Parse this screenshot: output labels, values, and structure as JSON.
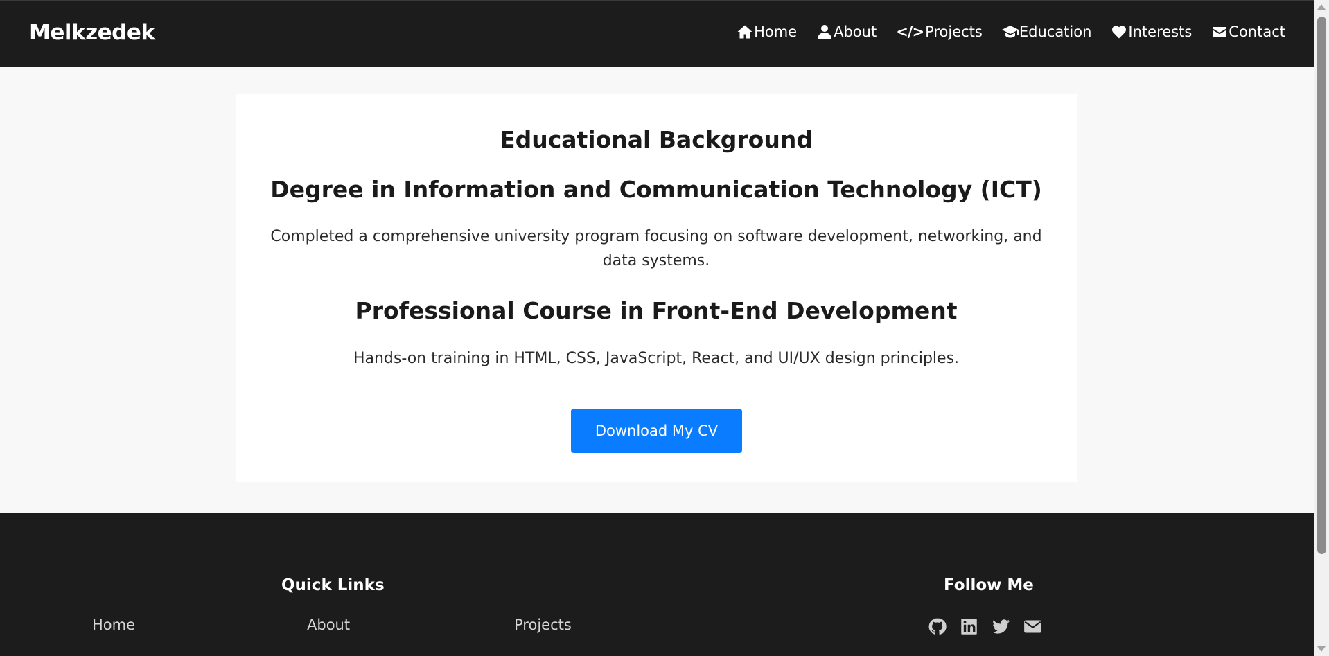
{
  "header": {
    "brand": "Melkzedek",
    "nav": [
      {
        "label": "Home",
        "icon": "home-icon"
      },
      {
        "label": "About",
        "icon": "user-icon"
      },
      {
        "label": "Projects",
        "icon": "code-icon"
      },
      {
        "label": "Education",
        "icon": "graduation-cap-icon"
      },
      {
        "label": "Interests",
        "icon": "heart-icon"
      },
      {
        "label": "Contact",
        "icon": "envelope-icon"
      }
    ]
  },
  "education": {
    "title": "Educational Background",
    "degree": {
      "title": "Degree in Information and Communication Technology (ICT)",
      "description": "Completed a comprehensive university program focusing on software development, networking, and data systems."
    },
    "course": {
      "title": "Professional Course in Front-End Development",
      "description": "Hands-on training in HTML, CSS, JavaScript, React, and UI/UX design principles."
    },
    "cv_button": "Download My CV"
  },
  "footer": {
    "quick_links_title": "Quick Links",
    "quick_links": [
      "Home",
      "About",
      "Projects"
    ],
    "follow_title": "Follow Me",
    "social_icons": [
      "github-icon",
      "linkedin-icon",
      "twitter-icon",
      "envelope-icon"
    ]
  },
  "colors": {
    "header_bg": "#1c1c1c",
    "page_bg": "#f8f8f8",
    "accent": "#0a7cff"
  }
}
